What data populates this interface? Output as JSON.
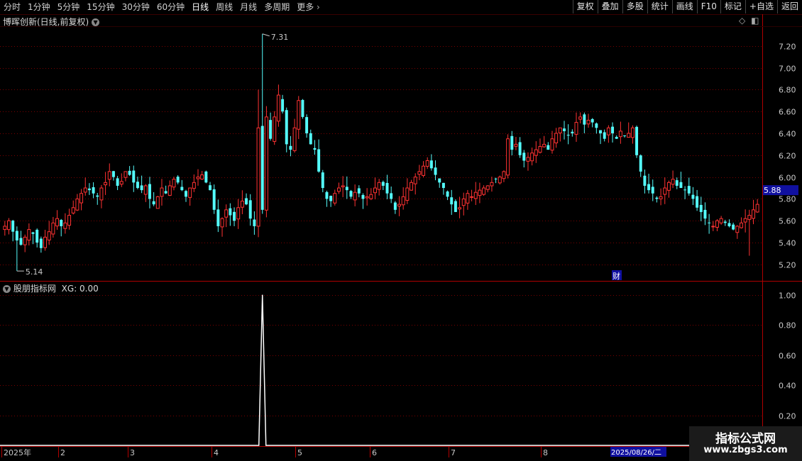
{
  "toolbar": {
    "periods": [
      "分时",
      "1分钟",
      "5分钟",
      "15分钟",
      "30分钟",
      "60分钟",
      "日线",
      "周线",
      "月线",
      "多周期",
      "更多"
    ],
    "active_period": "日线",
    "right_buttons": [
      "复权",
      "叠加",
      "多股",
      "统计",
      "画线",
      "F10",
      "标记",
      "+自选",
      "返回"
    ]
  },
  "main_chart": {
    "title": "博晖创新(日线,前复权)",
    "high_label": "7.31",
    "low_label": "5.14",
    "current_price": "5.88",
    "event_badge": "财",
    "colors": {
      "up": "#ff3232",
      "down": "#54fcfc",
      "grid": "#7a0000",
      "axis": "#b00000",
      "text": "#c8c8c8",
      "price_box": "#1010a0"
    }
  },
  "indicator": {
    "title": "股朋指标网",
    "value_label": "XG: 0.00"
  },
  "time_axis": {
    "cursor_date": "2025/08/26/二"
  },
  "watermark": {
    "line1": "指标公式网",
    "line2": "www.zbgs3.com"
  },
  "chart_data": [
    {
      "type": "candlestick",
      "title": "博晖创新(日线,前复权)",
      "y_ticks": [
        5.2,
        5.4,
        5.6,
        5.8,
        6.0,
        6.2,
        6.4,
        6.6,
        6.8,
        7.0,
        7.2
      ],
      "ylim": [
        5.05,
        7.38
      ],
      "x_ticks": [
        "2025年",
        "2",
        "3",
        "4",
        "5",
        "6",
        "7",
        "8"
      ],
      "highest": 7.31,
      "lowest": 5.14,
      "last_price": 5.88,
      "closes": [
        5.55,
        5.6,
        5.5,
        5.42,
        5.38,
        5.45,
        5.52,
        5.48,
        5.4,
        5.35,
        5.45,
        5.5,
        5.58,
        5.62,
        5.55,
        5.58,
        5.65,
        5.72,
        5.8,
        5.85,
        5.9,
        5.88,
        5.85,
        5.82,
        5.9,
        5.95,
        6.05,
        6.0,
        5.92,
        5.96,
        6.05,
        6.02,
        5.95,
        5.9,
        5.88,
        5.92,
        5.8,
        5.75,
        5.82,
        5.9,
        5.85,
        5.92,
        5.98,
        5.95,
        5.88,
        5.82,
        5.9,
        5.95,
        6.0,
        6.02,
        5.95,
        5.88,
        5.7,
        5.55,
        5.62,
        5.7,
        5.65,
        5.6,
        5.72,
        5.78,
        5.75,
        5.62,
        5.55,
        6.45,
        5.7,
        6.55,
        6.35,
        6.55,
        6.75,
        6.6,
        6.3,
        6.25,
        6.45,
        6.7,
        6.55,
        6.4,
        6.3,
        6.25,
        6.05,
        5.9,
        5.8,
        5.78,
        5.85,
        5.9,
        5.92,
        5.88,
        5.82,
        5.86,
        5.85,
        5.8,
        5.82,
        5.84,
        5.9,
        5.95,
        5.92,
        5.85,
        5.8,
        5.7,
        5.75,
        5.82,
        5.9,
        5.95,
        6.0,
        6.05,
        6.1,
        6.15,
        6.08,
        6.02,
        5.95,
        5.9,
        5.82,
        5.75,
        5.68,
        5.72,
        5.8,
        5.85,
        5.82,
        5.86,
        5.88,
        5.9,
        5.92,
        5.95,
        5.98,
        6.0,
        6.05,
        6.35,
        6.25,
        6.3,
        6.2,
        6.15,
        6.18,
        6.22,
        6.25,
        6.28,
        6.3,
        6.25,
        6.35,
        6.4,
        6.45,
        6.42,
        6.38,
        6.4,
        6.5,
        6.55,
        6.48,
        6.52,
        6.5,
        6.45,
        6.4,
        6.35,
        6.45,
        6.4,
        6.35,
        6.42,
        6.38,
        6.4,
        6.45,
        6.2,
        6.05,
        5.92,
        5.88,
        5.85,
        5.8,
        5.82,
        5.9,
        5.95,
        5.98,
        5.92,
        5.9,
        5.88,
        5.85,
        5.8,
        5.72,
        5.68,
        5.62,
        5.58,
        5.55,
        5.6,
        5.62,
        5.58,
        5.55,
        5.52,
        5.55,
        5.58,
        5.62,
        5.65,
        5.7,
        5.75
      ]
    },
    {
      "type": "line",
      "series": [
        {
          "name": "XG",
          "peak_value": 1.0,
          "baseline_value": 0.0
        }
      ],
      "y_ticks": [
        0.2,
        0.4,
        0.6,
        0.8,
        1.0
      ],
      "ylim": [
        0,
        1.05
      ]
    }
  ]
}
